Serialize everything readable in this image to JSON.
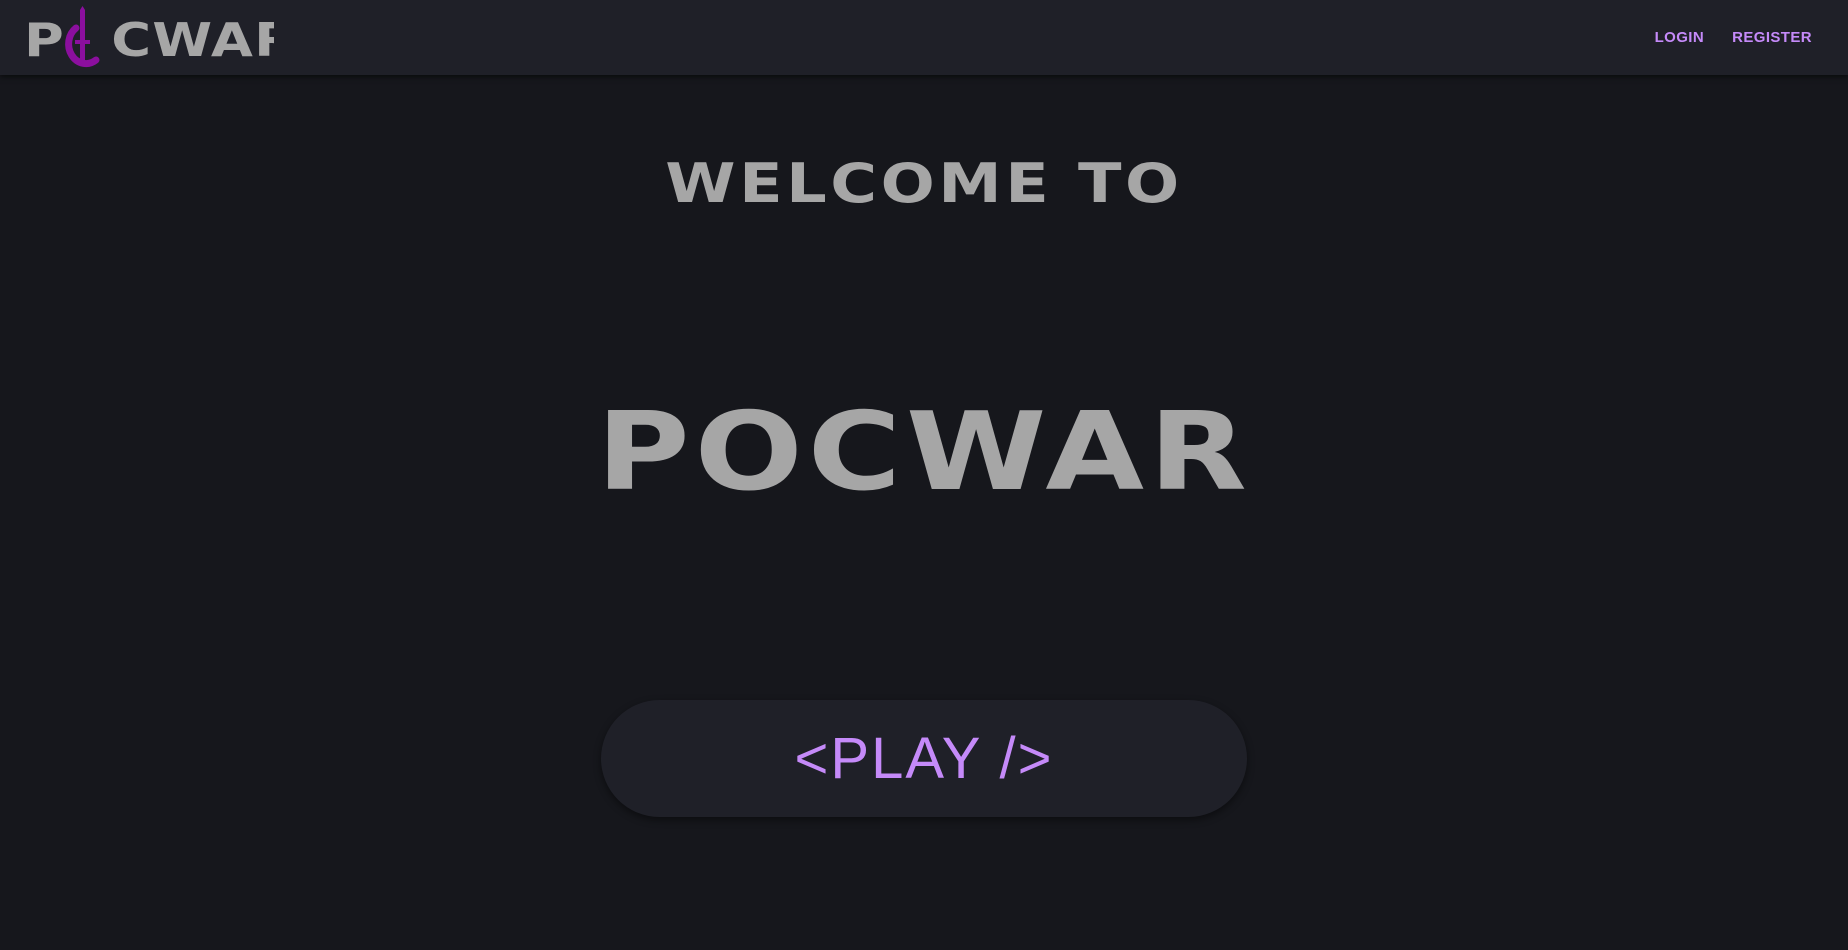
{
  "header": {
    "logo_text": "PCWAR",
    "nav": {
      "login_label": "LOGIN",
      "register_label": "REGISTER"
    }
  },
  "hero": {
    "welcome_text": "WELCOME TO",
    "title": "POCWAR",
    "play_label": "<PLAY />"
  },
  "colors": {
    "background": "#16171c",
    "header_background": "#1f2028",
    "accent": "#c58af9",
    "logo_accent": "#8b0f9e",
    "text_gray": "#a6a6a6"
  },
  "icons": {
    "logo_mark": "sword-ring-icon"
  }
}
